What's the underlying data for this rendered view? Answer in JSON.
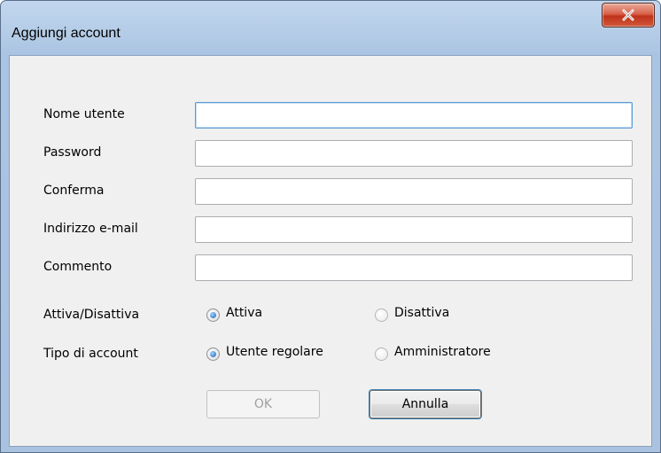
{
  "window": {
    "title": "Aggiungi account"
  },
  "form": {
    "fields": [
      {
        "label": "Nome utente",
        "value": "",
        "focused": true
      },
      {
        "label": "Password",
        "value": ""
      },
      {
        "label": "Conferma",
        "value": ""
      },
      {
        "label": "Indirizzo e-mail",
        "value": ""
      },
      {
        "label": "Commento",
        "value": ""
      }
    ],
    "status": {
      "label": "Attiva/Disattiva",
      "options": [
        "Attiva",
        "Disattiva"
      ],
      "selected": "Attiva"
    },
    "account_type": {
      "label": "Tipo di account",
      "options": [
        "Utente regolare",
        "Amministratore"
      ],
      "selected": "Utente regolare"
    }
  },
  "buttons": {
    "ok": "OK",
    "cancel": "Annulla",
    "ok_enabled": false
  },
  "icons": {
    "close": "close-icon"
  },
  "colors": {
    "title_bar": "#b3cbe6",
    "close_button": "#c7432a",
    "dialog_body": "#f0f0f0",
    "focus_border": "#5b9bd5"
  }
}
